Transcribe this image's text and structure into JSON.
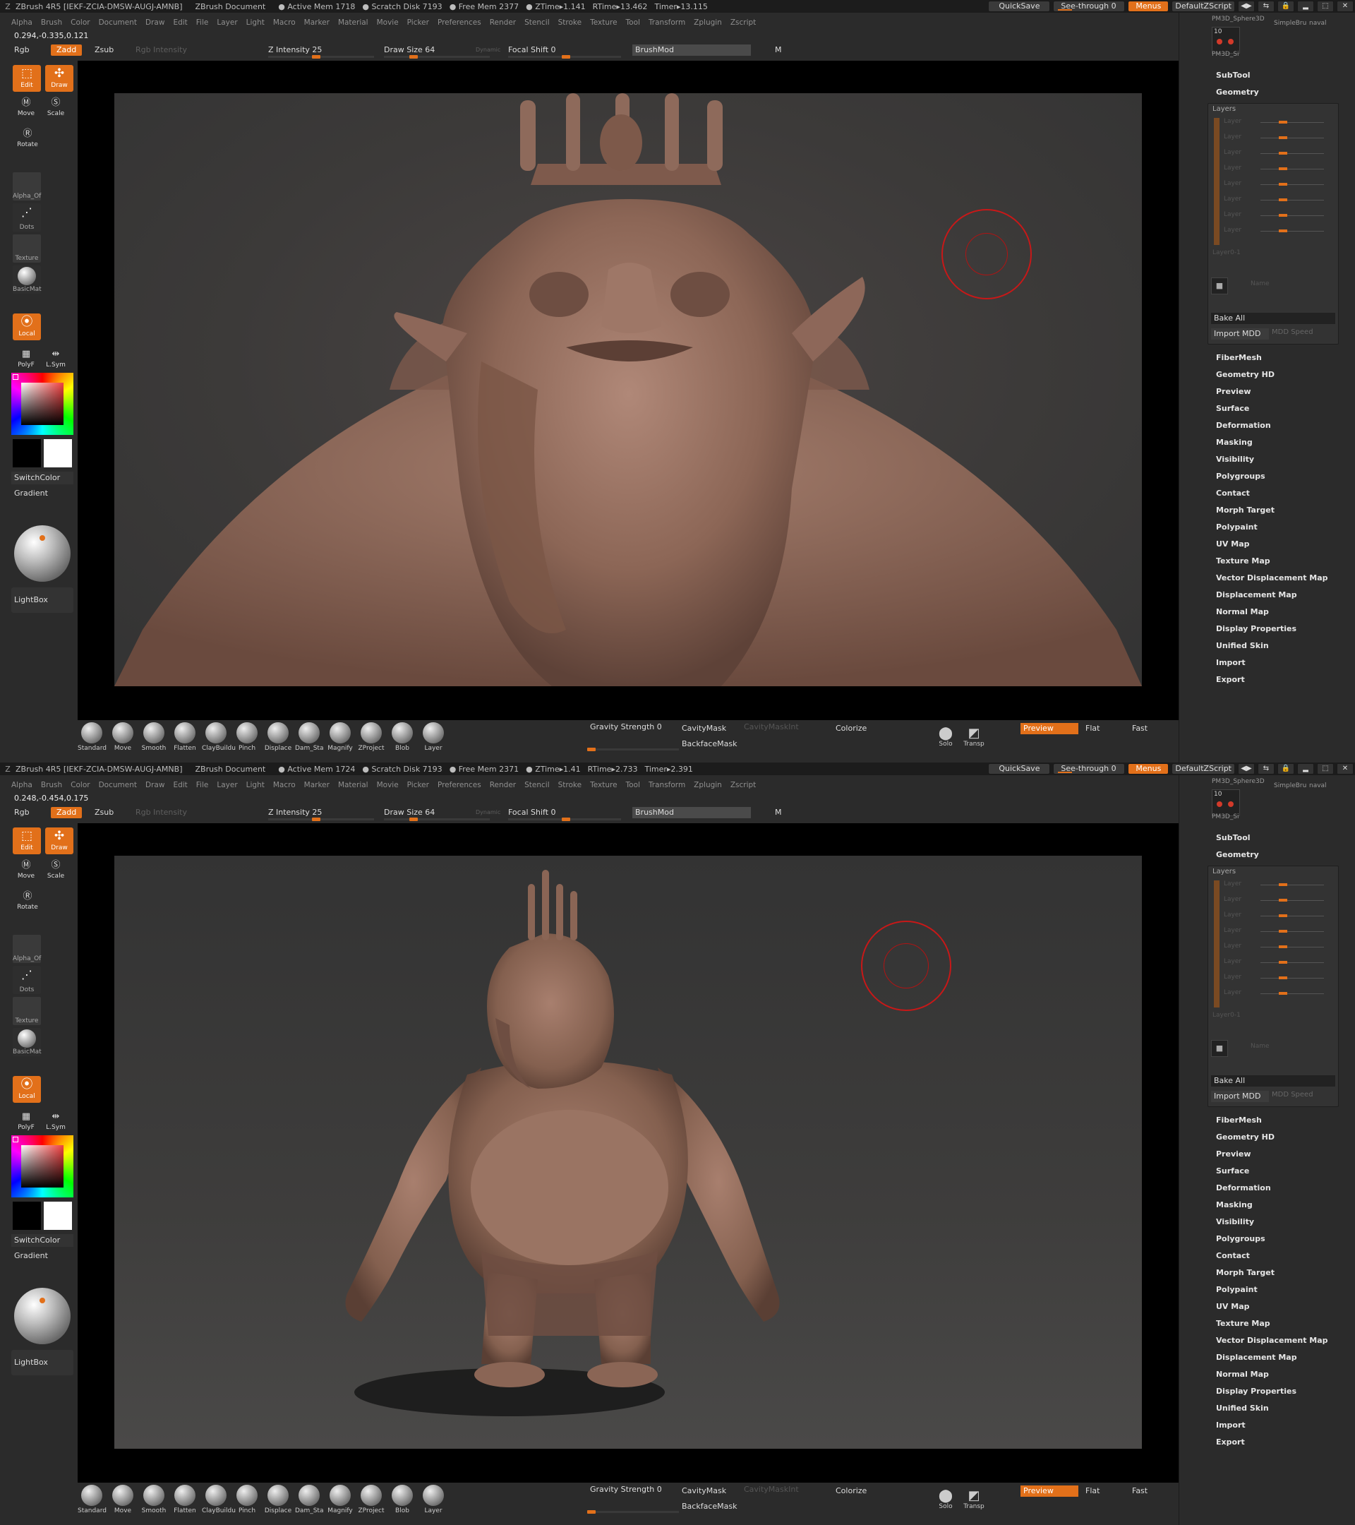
{
  "colors": {
    "accent": "#e2701a",
    "cursor_ring": "#c81818",
    "clay": "#9a7160"
  },
  "menus": [
    "Alpha",
    "Brush",
    "Color",
    "Document",
    "Draw",
    "Edit",
    "File",
    "Layer",
    "Light",
    "Macro",
    "Marker",
    "Material",
    "Movie",
    "Picker",
    "Preferences",
    "Render",
    "Stencil",
    "Stroke",
    "Texture",
    "Tool",
    "Transform",
    "Zplugin",
    "Zscript"
  ],
  "titlebar": {
    "zlogo": "Z",
    "app": "ZBrush 4R5 [IEKF-ZCIA-DMSW-AUGJ-AMNB]",
    "doc": "ZBrush Document",
    "quicksave": "QuickSave",
    "see_through": "See-through  0",
    "menus": "Menus",
    "script": "DefaultZScript",
    "right_icons": [
      "◀▶",
      "⇆",
      "▂",
      "⬚",
      "✕"
    ]
  },
  "toolbar": {
    "rgb": "Rgb",
    "zadd": "Zadd",
    "zsub": "Zsub",
    "rgb_intensity": "Rgb Intensity",
    "z_intensity": "Z Intensity 25",
    "draw_size": "Draw Size 64",
    "dynamic": "Dynamic",
    "focal_shift": "Focal Shift 0",
    "brushmod": "BrushMod",
    "m": "M"
  },
  "left": {
    "edit": "Edit",
    "draw": "Draw",
    "move": "Move",
    "scale": "Scale",
    "rotate": "Rotate",
    "alpha": "Alpha_Of",
    "dots": "Dots",
    "texture": "Texture",
    "material": "BasicMat",
    "local": "Local",
    "polyf": "PolyF",
    "lsym": "L.Sym",
    "switchcolor": "SwitchColor",
    "gradient": "Gradient",
    "lightbox": "LightBox"
  },
  "bottom": {
    "brushes": [
      "Standard",
      "Move",
      "Smooth",
      "Flatten",
      "ClayBuildu",
      "Pinch",
      "Displace",
      "Dam_Sta",
      "Magnify",
      "ZProject",
      "Blob",
      "Layer"
    ],
    "gravity": "Gravity Strength 0",
    "cavitymask": "CavityMask",
    "cavitymaskint": "CavityMaskInt",
    "backfacemask": "BackfaceMask",
    "colorize": "Colorize",
    "solo": "Solo",
    "transp": "Transp",
    "preview": "Preview",
    "flat": "Flat",
    "fast": "Fast"
  },
  "right": {
    "top_labels": [
      "PM3D_Sphere3D",
      "SimpleBru",
      "naval",
      "PM3D_Si"
    ],
    "thumb_count": "10",
    "subtool": "SubTool",
    "geometry": "Geometry",
    "layers_header": "Layers",
    "layer_rows": [
      "Layer",
      "Layer",
      "Layer",
      "Layer",
      "Layer",
      "Layer",
      "Layer",
      "Layer"
    ],
    "layer_index": "Layer0-1",
    "name": "Name",
    "bake_all": "Bake All",
    "import_mdd": "Import MDD",
    "mdd_speed": "MDD Speed",
    "items": [
      "FiberMesh",
      "Geometry HD",
      "Preview",
      "Surface",
      "Deformation",
      "Masking",
      "Visibility",
      "Polygroups",
      "Contact",
      "Morph Target",
      "Polypaint",
      "UV Map",
      "Texture Map",
      "Vector Displacement Map",
      "Displacement Map",
      "Normal Map",
      "Display Properties",
      "Unified Skin",
      "Import",
      "Export"
    ]
  },
  "screens": [
    {
      "coords": "0.294,-0.335,0.121",
      "stats": [
        "● Active Mem 1718",
        "● Scratch Disk 7193",
        "● Free Mem 2377",
        "● ZTime▸1.141",
        "RTime▸13.462",
        "Timer▸13.115"
      ],
      "view": "Close-up bust of a troll-like creature with a crown of horns"
    },
    {
      "coords": "0.248,-0.454,0.175",
      "stats": [
        "● Active Mem 1724",
        "● Scratch Disk 7193",
        "● Free Mem 2371",
        "● ZTime▸1.41",
        "RTime▸2.733",
        "Timer▸2.391"
      ],
      "view": "Full-body troll figure with loincloth casting a shadow"
    }
  ]
}
